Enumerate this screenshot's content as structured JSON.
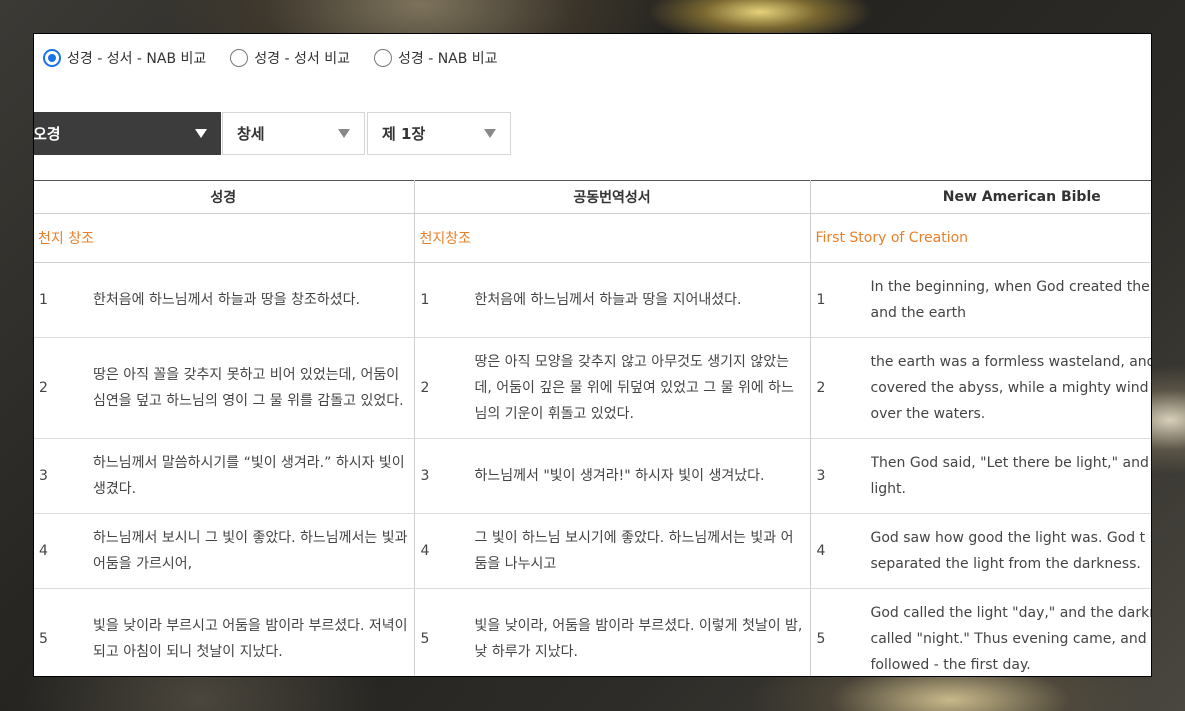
{
  "radio_options": [
    {
      "label": "성경 - 성서 - NAB 비교",
      "checked": true
    },
    {
      "label": "성경 - 성서 비교",
      "checked": false
    },
    {
      "label": "성경 - NAB 비교",
      "checked": false
    }
  ],
  "selects": {
    "testament": "오경",
    "book": "창세",
    "chapter": "제 1장"
  },
  "table": {
    "headers": [
      "성경",
      "공동번역성서",
      "New American Bible"
    ],
    "section_titles": [
      "천지 창조",
      "천지창조",
      "First Story of Creation"
    ],
    "rows": [
      {
        "n": "1",
        "c1": "한처음에 하느님께서 하늘과 땅을 창조하셨다.",
        "c2": "한처음에 하느님께서 하늘과 땅을 지어내셨다.",
        "c3": [
          "In the beginning, when God created the",
          "and the earth"
        ]
      },
      {
        "n": "2",
        "c1": "땅은 아직 꼴을 갖추지 못하고 비어 있었는데, 어둠이 심연을 덮고 하느님의 영이 그 물 위를 감돌고 있었다.",
        "c2": "땅은 아직 모양을 갖추지 않고 아무것도 생기지 않았는데, 어둠이 깊은 물 위에 뒤덮여 있었고 그 물 위에 하느님의 기운이 휘돌고 있었다.",
        "c3": [
          "the earth was a formless wasteland, and",
          "covered the abyss, while a mighty wind s",
          "over the waters."
        ]
      },
      {
        "n": "3",
        "c1": "하느님께서 말씀하시기를 “빛이 생겨라.” 하시자 빛이 생겼다.",
        "c2": "하느님께서 \"빛이 생겨라!\" 하시자 빛이 생겨났다.",
        "c3": [
          "Then God said, \"Let there be light,\" and",
          "light."
        ]
      },
      {
        "n": "4",
        "c1": "하느님께서 보시니 그 빛이 좋았다. 하느님께서는 빛과 어둠을 가르시어,",
        "c2": "그 빛이 하느님 보시기에 좋았다. 하느님께서는 빛과 어둠을 나누시고",
        "c3": [
          "God saw how good the light was. God t",
          "separated the light from the darkness."
        ]
      },
      {
        "n": "5",
        "c1": "빛을 낮이라 부르시고 어둠을 밤이라 부르셨다. 저녁이 되고 아침이 되니 첫날이 지났다.",
        "c2": "빛을 낮이라, 어둠을 밤이라 부르셨다. 이렇게 첫날이 밤, 낮 하루가 지났다.",
        "c3": [
          "God called the light \"day,\" and the darkn",
          "called \"night.\" Thus evening came, and m",
          "followed - the first day."
        ]
      }
    ]
  },
  "colors": {
    "accent_blue": "#1a73e8",
    "section_orange": "#e8802a",
    "dark_select": "#3c3c3c"
  }
}
